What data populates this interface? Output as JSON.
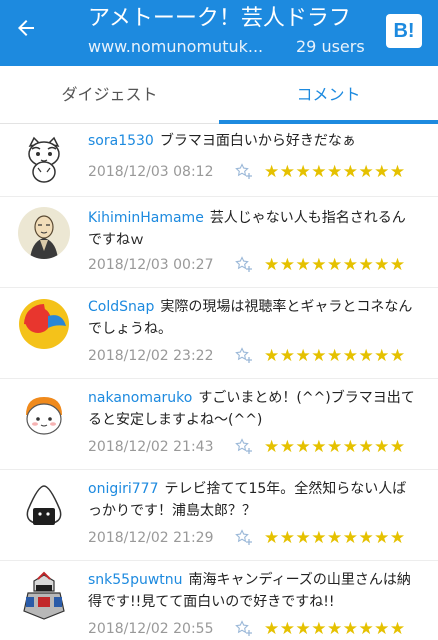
{
  "header": {
    "title": "アメトーーク！芸人ドラフ",
    "url": "www.nomunomutuk...",
    "users": "29 users",
    "hatena_button": "B!",
    "background": "#1d8adf"
  },
  "tabs": [
    {
      "label": "ダイジェスト",
      "selected": false
    },
    {
      "label": "コメント",
      "selected": true
    }
  ],
  "comments": [
    {
      "user": "sora1530",
      "text": "ブラマヨ面白いから好きだなぁ",
      "time": "2018/12/03 08:12",
      "stars": "★★★★★★★★★",
      "avatar": "cat-avatar-icon"
    },
    {
      "user": "KihiminHamame",
      "text": "芸人じゃない人も指名されるんですねｗ",
      "time": "2018/12/03 00:27",
      "stars": "★★★★★★★★★",
      "avatar": "monk-avatar-icon"
    },
    {
      "user": "ColdSnap",
      "text": "実際の現場は視聴率とギャラとコネなんでしょうね。",
      "time": "2018/12/02 23:22",
      "stars": "★★★★★★★★★",
      "avatar": "red-blue-circle-avatar-icon"
    },
    {
      "user": "nakanomaruko",
      "text": "すごいまとめ！(^^)ブラマヨ出てると安定しますよね〜(^^)",
      "time": "2018/12/02 21:43",
      "stars": "★★★★★★★★★",
      "avatar": "maru-character-avatar-icon"
    },
    {
      "user": "onigiri777",
      "text": "テレビ捨てて15年。全然知らない人ばっかりです！浦島太郎？？",
      "time": "2018/12/02 21:29",
      "stars": "★★★★★★★★★",
      "avatar": "onigiri-avatar-icon"
    },
    {
      "user": "snk55puwtnu",
      "text": "南海キャンディーズの山里さんは納得です!!見てて面白いので好きですね!!",
      "time": "2018/12/02 20:55",
      "stars": "★★★★★★★★★",
      "avatar": "robot-avatar-icon"
    }
  ],
  "colors": {
    "accent": "#1d8adf",
    "star": "#e5c100",
    "timestamp": "#999999"
  }
}
